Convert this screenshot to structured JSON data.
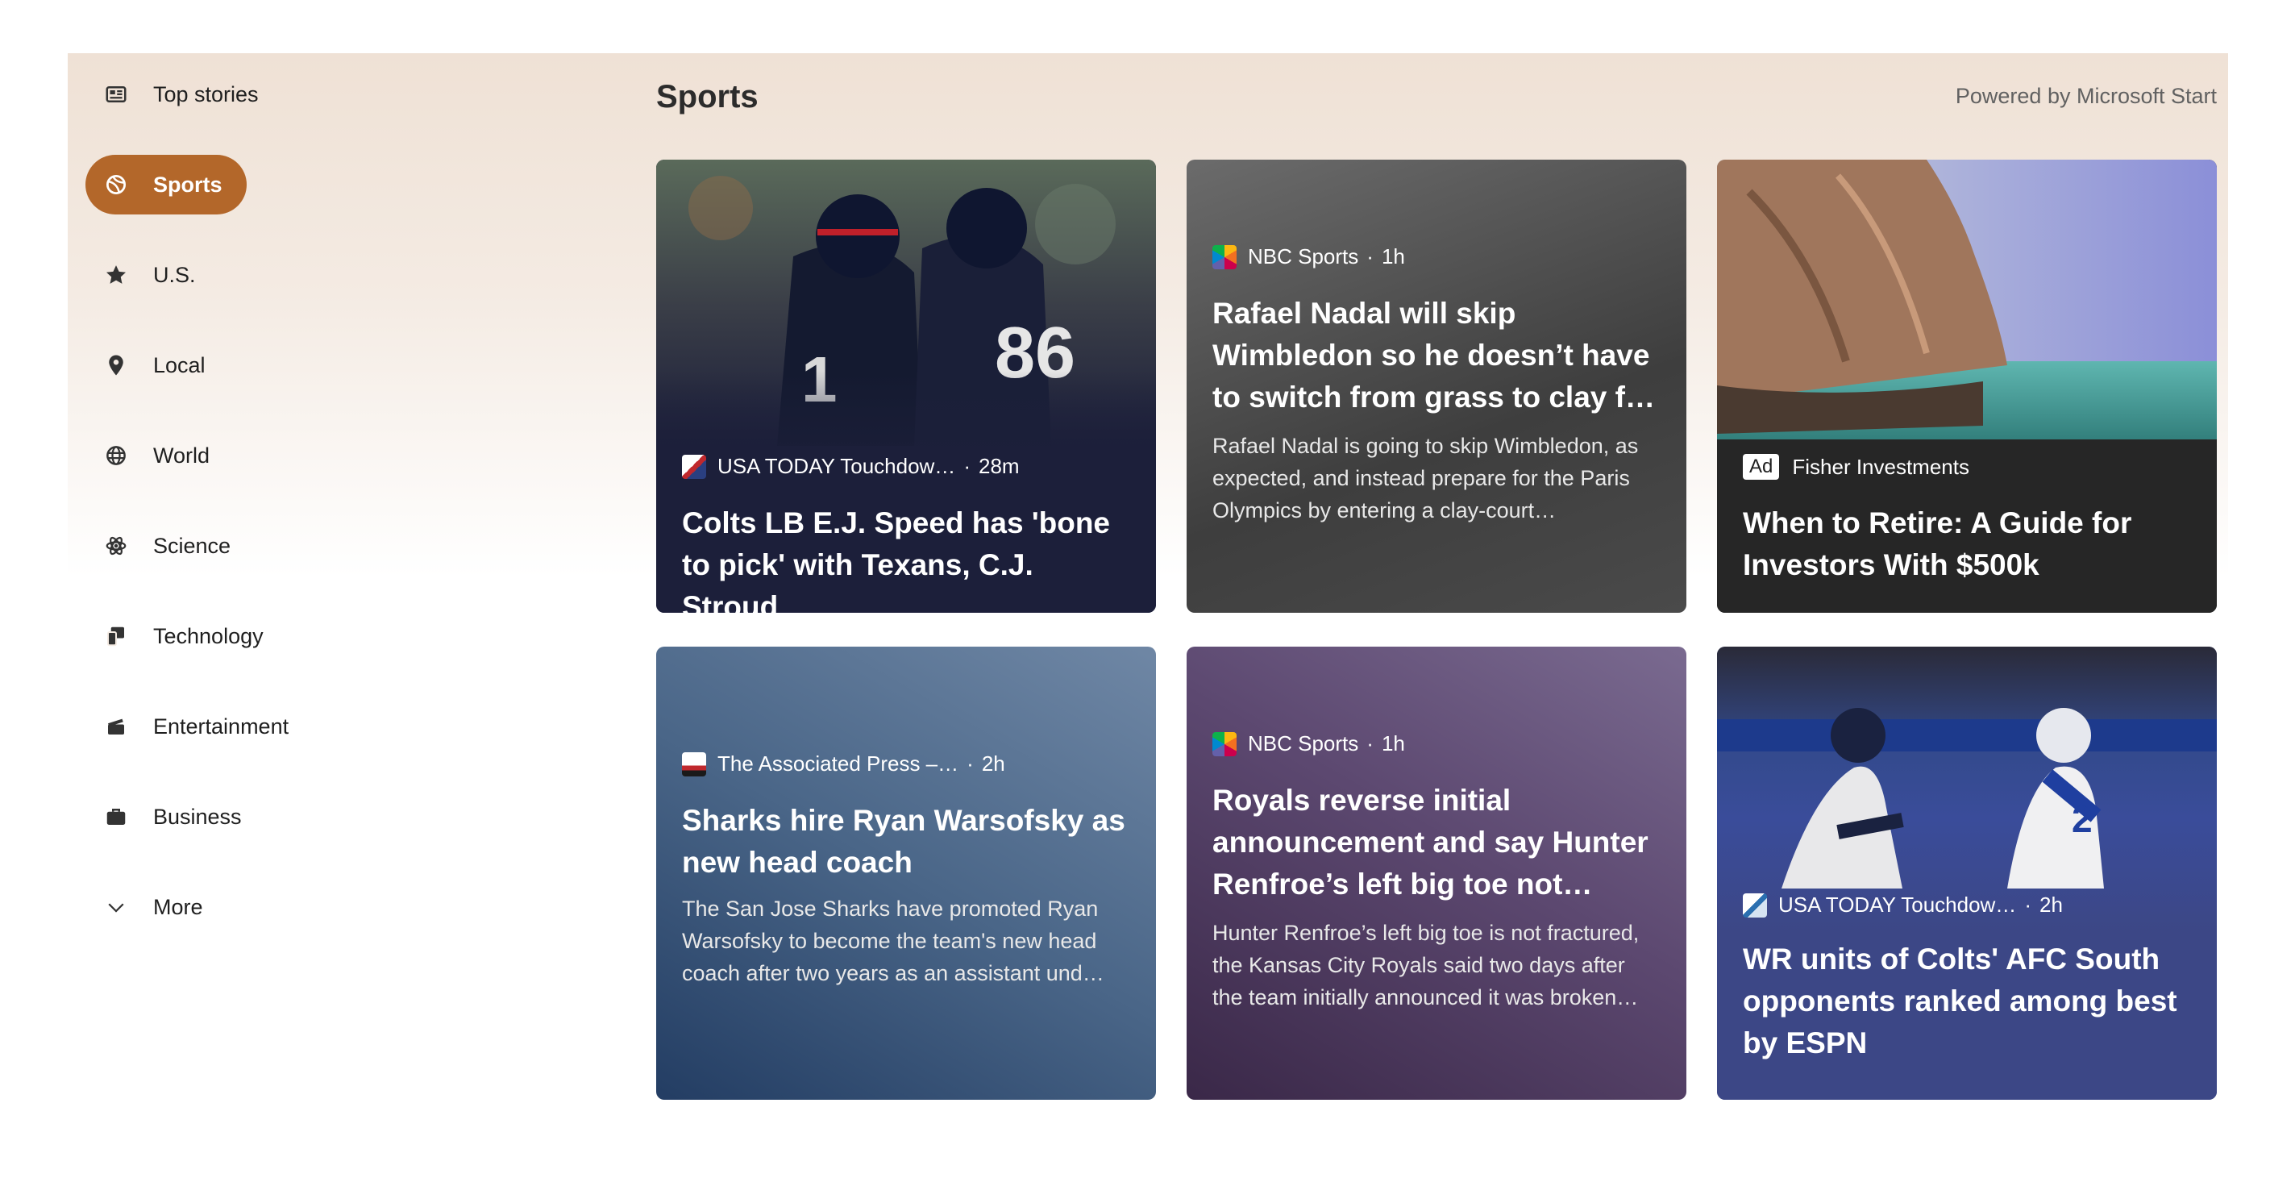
{
  "sidebar": {
    "items": [
      {
        "label": "Top stories",
        "icon": "newspaper-icon",
        "active": false
      },
      {
        "label": "Sports",
        "icon": "sports-ball-icon",
        "active": true
      },
      {
        "label": "U.S.",
        "icon": "star-icon",
        "active": false
      },
      {
        "label": "Local",
        "icon": "location-pin-icon",
        "active": false
      },
      {
        "label": "World",
        "icon": "globe-icon",
        "active": false
      },
      {
        "label": "Science",
        "icon": "atom-icon",
        "active": false
      },
      {
        "label": "Technology",
        "icon": "devices-icon",
        "active": false
      },
      {
        "label": "Entertainment",
        "icon": "clapperboard-icon",
        "active": false
      },
      {
        "label": "Business",
        "icon": "briefcase-icon",
        "active": false
      },
      {
        "label": "More",
        "icon": "chevron-down-icon",
        "active": false
      }
    ]
  },
  "header": {
    "title": "Sports",
    "powered_by": "Powered by Microsoft Start"
  },
  "cards": [
    {
      "source": "USA TODAY Touchdow…",
      "time": "28m",
      "title": "Colts LB E.J. Speed has 'bone to pick' with Texans, C.J. Stroud",
      "description": ""
    },
    {
      "source": "NBC Sports",
      "time": "1h",
      "title": "Rafael Nadal will skip Wimbledon so he doesn’t have to switch from grass to clay f…",
      "description": "Rafael Nadal is going to skip Wimbledon, as expected, and instead prepare for the Paris Olympics by entering a clay-court…"
    },
    {
      "ad_label": "Ad",
      "source": "Fisher Investments",
      "title": "When to Retire: A Guide for Investors With $500k"
    },
    {
      "source": "The Associated Press –…",
      "time": "2h",
      "title": "Sharks hire Ryan Warsofsky as new head coach",
      "description": "The San Jose Sharks have promoted Ryan Warsofsky to become the team's new head coach after two years as an assistant und…"
    },
    {
      "source": "NBC Sports",
      "time": "1h",
      "title": "Royals reverse initial announcement and say Hunter Renfroe’s left big toe not…",
      "description": "Hunter Renfroe’s left big toe is not fractured, the Kansas City Royals said two days after the team initially announced it was broken…"
    },
    {
      "source": "USA TODAY Touchdow…",
      "time": "2h",
      "title": "WR units of Colts' AFC South opponents ranked among best by ESPN"
    }
  ],
  "colors": {
    "accent": "#b3672a",
    "background_top": "#efe1d5"
  }
}
